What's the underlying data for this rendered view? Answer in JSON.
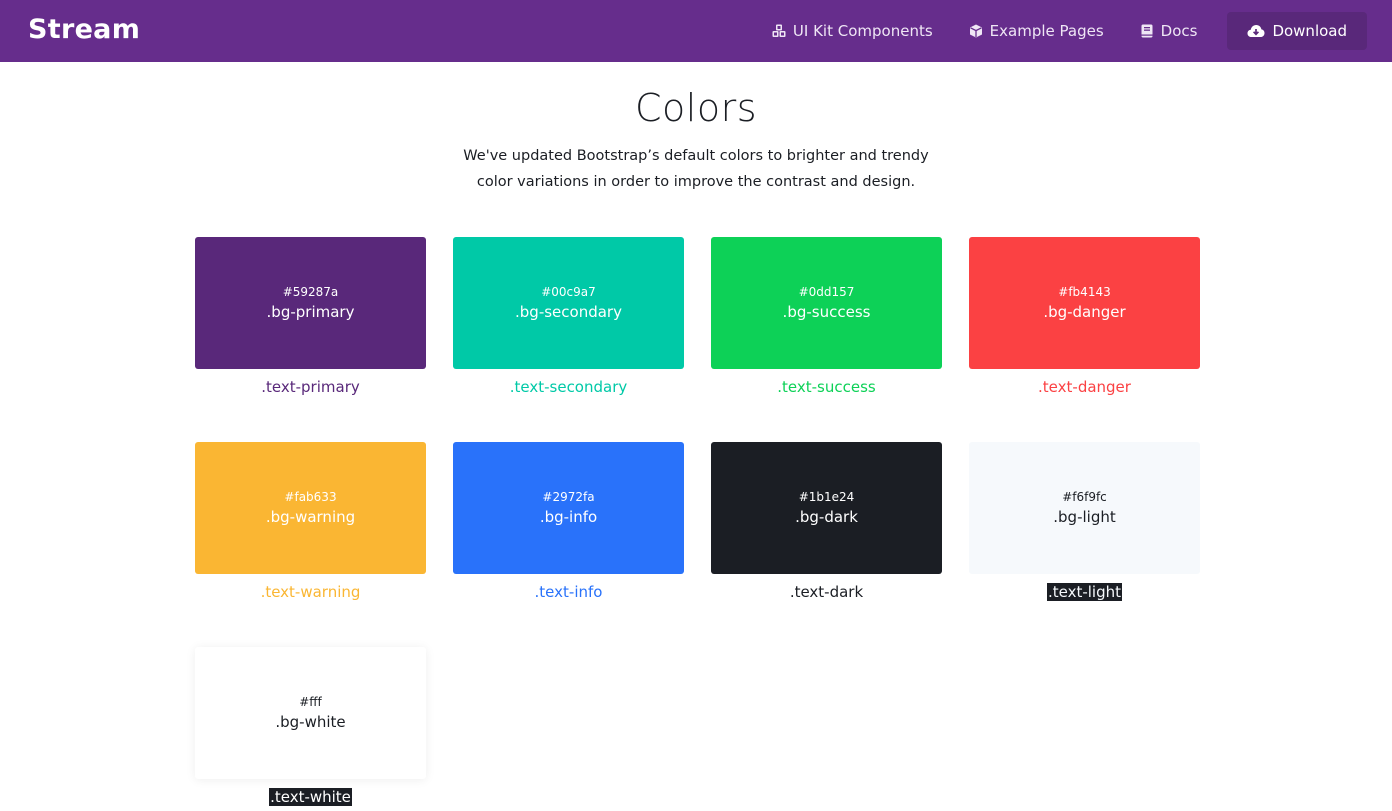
{
  "navbar": {
    "brand": "Stream",
    "items": [
      {
        "label": "UI Kit Components",
        "icon": "cubes-icon"
      },
      {
        "label": "Example Pages",
        "icon": "cube-icon"
      },
      {
        "label": "Docs",
        "icon": "book-icon"
      },
      {
        "label": "Download",
        "icon": "cloud-download-icon"
      }
    ]
  },
  "page": {
    "title": "Colors",
    "subtitle": "We've updated Bootstrap’s default colors to brighter and trendy color variations in order to improve the contrast and design."
  },
  "colors": [
    {
      "hex": "#59287a",
      "bg_class": ".bg-primary",
      "text_class": ".text-primary",
      "text_color": "#59287a"
    },
    {
      "hex": "#00c9a7",
      "bg_class": ".bg-secondary",
      "text_class": ".text-secondary",
      "text_color": "#00c9a7"
    },
    {
      "hex": "#0dd157",
      "bg_class": ".bg-success",
      "text_class": ".text-success",
      "text_color": "#0dd157"
    },
    {
      "hex": "#fb4143",
      "bg_class": ".bg-danger",
      "text_class": ".text-danger",
      "text_color": "#fb4143"
    },
    {
      "hex": "#fab633",
      "bg_class": ".bg-warning",
      "text_class": ".text-warning",
      "text_color": "#fab633"
    },
    {
      "hex": "#2972fa",
      "bg_class": ".bg-info",
      "text_class": ".text-info",
      "text_color": "#2972fa"
    },
    {
      "hex": "#1b1e24",
      "bg_class": ".bg-dark",
      "text_class": ".text-dark",
      "text_color": "#1b1e24"
    },
    {
      "hex": "#f6f9fc",
      "bg_class": ".bg-light",
      "text_class": ".text-light",
      "text_color": "#f6f9fc"
    },
    {
      "hex": "#fff",
      "bg_class": ".bg-white",
      "text_class": ".text-white",
      "text_color": "#ffffff"
    }
  ],
  "theme": {
    "navbar_bg": "#662d8c",
    "download_bg": "#59287a"
  }
}
